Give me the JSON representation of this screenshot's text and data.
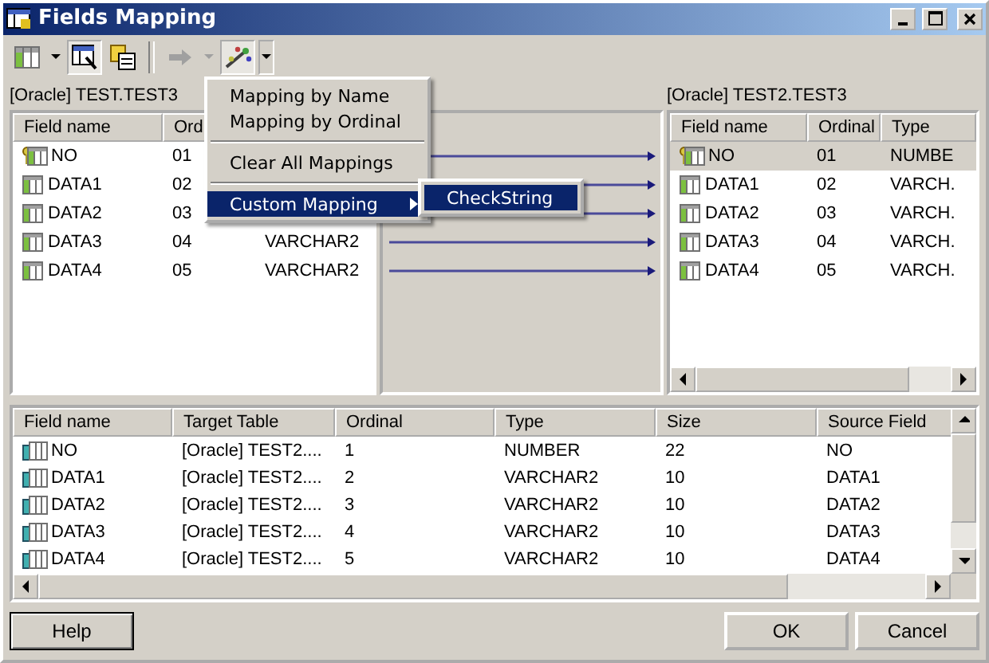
{
  "window": {
    "title": "Fields Mapping"
  },
  "source": {
    "label": "[Oracle] TEST.TEST3",
    "columns": [
      "Field name",
      "Ord",
      ""
    ],
    "rows": [
      {
        "key": true,
        "name": "NO",
        "ordinal": "01",
        "type": ""
      },
      {
        "key": false,
        "name": "DATA1",
        "ordinal": "02",
        "type": ""
      },
      {
        "key": false,
        "name": "DATA2",
        "ordinal": "03",
        "type": ""
      },
      {
        "key": false,
        "name": "DATA3",
        "ordinal": "04",
        "type": "VARCHAR2"
      },
      {
        "key": false,
        "name": "DATA4",
        "ordinal": "05",
        "type": "VARCHAR2"
      }
    ]
  },
  "mappings": [
    {
      "mapped": true
    },
    {
      "mapped": true
    },
    {
      "mapped": true
    },
    {
      "mapped": true
    },
    {
      "mapped": true
    }
  ],
  "target": {
    "label": "[Oracle] TEST2.TEST3",
    "columns": [
      "Field name",
      "Ordinal",
      "Type"
    ],
    "rows": [
      {
        "key": true,
        "selected": true,
        "name": "NO",
        "ordinal": "01",
        "type": "NUMBE"
      },
      {
        "key": false,
        "selected": false,
        "name": "DATA1",
        "ordinal": "02",
        "type": "VARCH."
      },
      {
        "key": false,
        "selected": false,
        "name": "DATA2",
        "ordinal": "03",
        "type": "VARCH."
      },
      {
        "key": false,
        "selected": false,
        "name": "DATA3",
        "ordinal": "04",
        "type": "VARCH."
      },
      {
        "key": false,
        "selected": false,
        "name": "DATA4",
        "ordinal": "05",
        "type": "VARCH."
      }
    ]
  },
  "menu": {
    "items": [
      {
        "kind": "item",
        "label": "Mapping by Name",
        "selected": false
      },
      {
        "kind": "item",
        "label": "Mapping by Ordinal",
        "selected": false
      },
      {
        "kind": "separator"
      },
      {
        "kind": "item",
        "label": "Clear All Mappings",
        "selected": false
      },
      {
        "kind": "separator"
      },
      {
        "kind": "submenu",
        "label": "Custom Mapping",
        "selected": true
      }
    ],
    "submenu": [
      {
        "label": "CheckString",
        "selected": true
      }
    ]
  },
  "result": {
    "columns": [
      "Field name",
      "Target Table",
      "Ordinal",
      "Type",
      "Size",
      "Source Field"
    ],
    "rows": [
      [
        "NO",
        "[Oracle] TEST2....",
        "1",
        "NUMBER",
        "22",
        "NO"
      ],
      [
        "DATA1",
        "[Oracle] TEST2....",
        "2",
        "VARCHAR2",
        "10",
        "DATA1"
      ],
      [
        "DATA2",
        "[Oracle] TEST2....",
        "3",
        "VARCHAR2",
        "10",
        "DATA2"
      ],
      [
        "DATA3",
        "[Oracle] TEST2....",
        "4",
        "VARCHAR2",
        "10",
        "DATA3"
      ],
      [
        "DATA4",
        "[Oracle] TEST2....",
        "5",
        "VARCHAR2",
        "10",
        "DATA4"
      ]
    ]
  },
  "buttons": {
    "help": "Help",
    "ok": "OK",
    "cancel": "Cancel"
  }
}
